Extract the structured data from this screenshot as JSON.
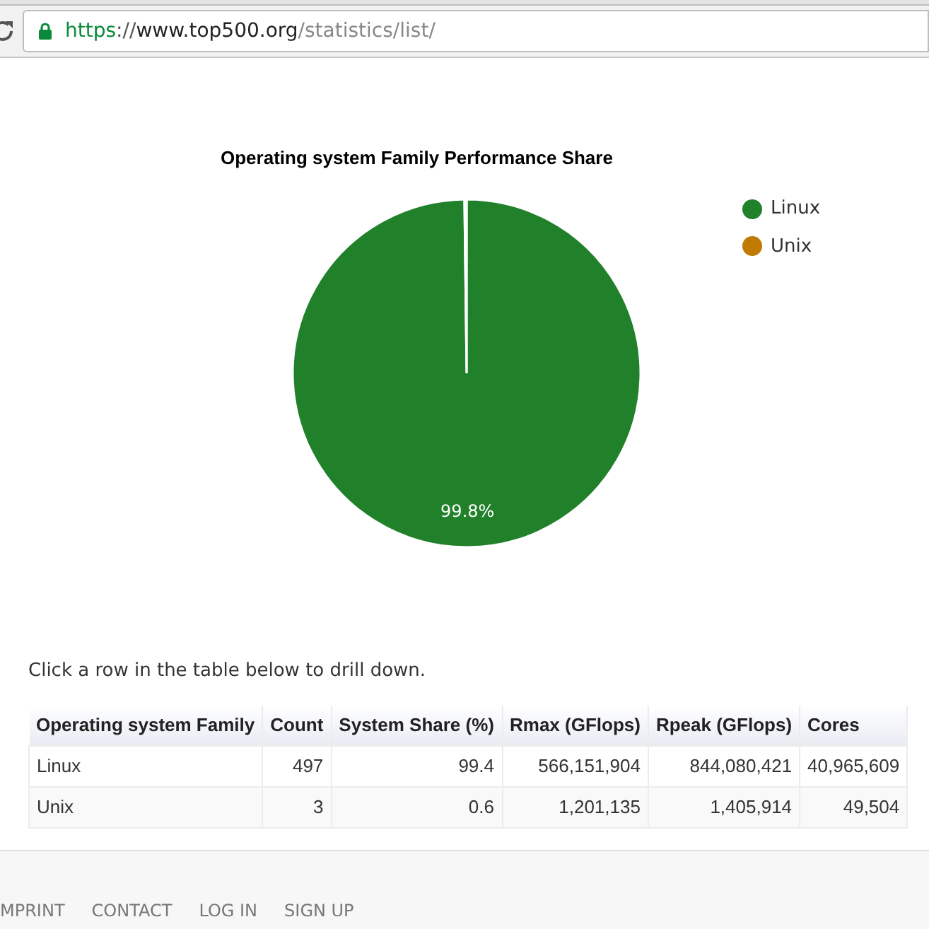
{
  "address_bar": {
    "scheme": "https",
    "separator": "://",
    "host": "www.top500.org",
    "path": "/statistics/list/"
  },
  "chart": {
    "chart_data": {
      "type": "pie",
      "title": "Operating system Family Performance Share",
      "categories": [
        "Linux",
        "Unix"
      ],
      "values": [
        99.8,
        0.2
      ],
      "legend": "right",
      "colors": [
        "#21802a",
        "#c07a00"
      ],
      "value_labels": [
        "99.8%",
        null
      ]
    }
  },
  "instruction": "Click a row in the table below to drill down.",
  "table": {
    "columns": [
      "Operating system Family",
      "Count",
      "System Share (%)",
      "Rmax (GFlops)",
      "Rpeak (GFlops)",
      "Cores"
    ],
    "rows": [
      [
        "Linux",
        "497",
        "99.4",
        "566,151,904",
        "844,080,421",
        "40,965,609"
      ],
      [
        "Unix",
        "3",
        "0.6",
        "1,201,135",
        "1,405,914",
        "49,504"
      ]
    ]
  },
  "footer": {
    "links": [
      "MPRINT",
      "CONTACT",
      "LOG IN",
      "SIGN UP"
    ]
  }
}
